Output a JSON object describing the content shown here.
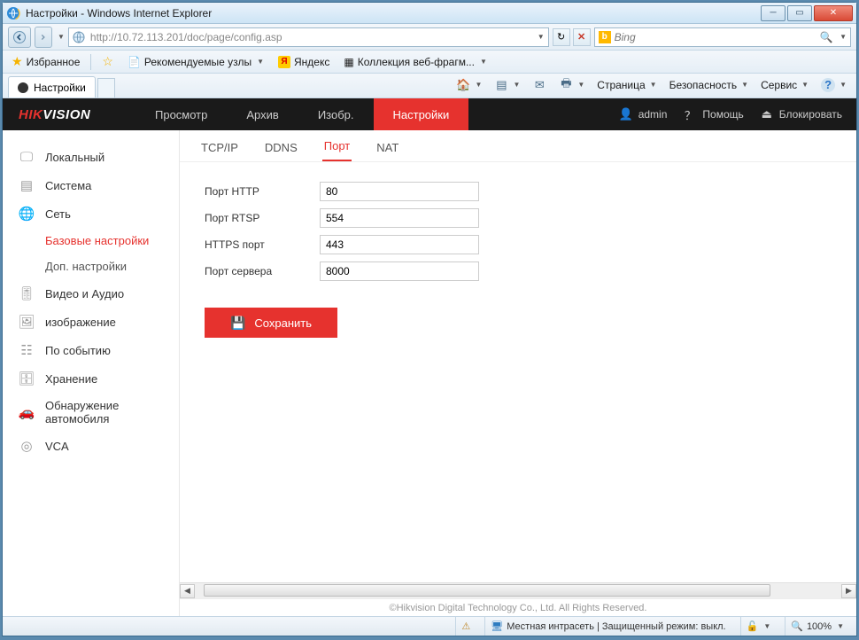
{
  "window": {
    "title": "Настройки - Windows Internet Explorer"
  },
  "address": {
    "url": "http://10.72.113.201/doc/page/config.asp"
  },
  "search": {
    "placeholder": "Bing"
  },
  "favbar": {
    "favorites": "Избранное",
    "recommended": "Рекомендуемые узлы",
    "yandex": "Яндекс",
    "webfrag": "Коллекция веб-фрагм..."
  },
  "tab": {
    "label": "Настройки"
  },
  "cmd": {
    "page": "Страница",
    "security": "Безопасность",
    "service": "Сервис"
  },
  "hik": {
    "logo1": "HIK",
    "logo2": "VISION",
    "nav": {
      "preview": "Просмотр",
      "archive": "Архив",
      "image": "Изобр.",
      "settings": "Настройки"
    },
    "top": {
      "user": "admin",
      "help": "Помощь",
      "lock": "Блокировать"
    }
  },
  "sidebar": {
    "local": "Локальный",
    "system": "Система",
    "network": "Сеть",
    "basic": "Базовые настройки",
    "advanced": "Доп. настройки",
    "va": "Видео и Аудио",
    "img": "изображение",
    "event": "По событию",
    "storage": "Хранение",
    "vehicle": "Обнаружение автомобиля",
    "vca": "VCA"
  },
  "subtabs": {
    "tcpip": "TCP/IP",
    "ddns": "DDNS",
    "port": "Порт",
    "nat": "NAT"
  },
  "form": {
    "http_label": "Порт HTTP",
    "http_value": "80",
    "rtsp_label": "Порт RTSP",
    "rtsp_value": "554",
    "https_label": "HTTPS порт",
    "https_value": "443",
    "server_label": "Порт сервера",
    "server_value": "8000",
    "save": "Сохранить"
  },
  "copyright": "©Hikvision Digital Technology Co., Ltd. All Rights Reserved.",
  "status": {
    "zone": "Местная интрасеть | Защищенный режим: выкл.",
    "zoom": "100%"
  }
}
